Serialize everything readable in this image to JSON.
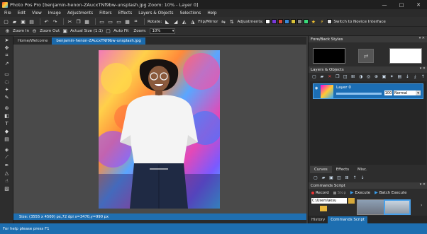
{
  "window": {
    "title": "Photo Pos Pro [benjamin-henon-ZAucxTNf9bw-unsplash.jpg Zoom: 10% - Layer 0]",
    "minimize": "—",
    "maximize": "□",
    "close": "✕"
  },
  "menu": [
    "File",
    "Edit",
    "View",
    "Image",
    "Adjustments",
    "Filters",
    "Effects",
    "Layers & Objects",
    "Selections",
    "Help"
  ],
  "toolbar1": {
    "rotate_label": "Rotate:",
    "flip_label": "Flip/Mirror",
    "adjustments_label": "Adjustments:",
    "novice_label": "Switch to Novice Interface"
  },
  "toolbar2": {
    "zoom_in": "Zoom In",
    "zoom_out": "Zoom Out",
    "actual_size": "Actual Size (1:1)",
    "auto_fit": "Auto Fit",
    "zoom_label": "Zoom:",
    "zoom_value": "10%"
  },
  "tabs": {
    "home": "Home/Welcome",
    "document": "benjamin-henon-ZAucxTNf9bw-unsplash.jpg"
  },
  "canvas_status": "Size: (3555 x 4500) px,72 dpi   x=3470,y=990 px",
  "statusbar": "For help please press F1",
  "panels": {
    "fore_back": "Fore/Back Styles",
    "layers": "Layers & Objects",
    "layer": {
      "name": "Layer 0",
      "opacity": "100",
      "opacity_fraction": 1.0,
      "blend": "Normal"
    },
    "subtabs": [
      "Curves",
      "Effects",
      "Misc."
    ],
    "commands": "Commands Script",
    "record": "Record",
    "stop": "Stop",
    "execute": "Execute",
    "batch": "Batch Execute",
    "path": "C:\\Users\\aksu",
    "bottom_tabs": [
      "History",
      "Commands Script"
    ]
  },
  "colors": {
    "accent": "#1d6eb0",
    "foreground": "#000000",
    "background": "#ffffff"
  }
}
